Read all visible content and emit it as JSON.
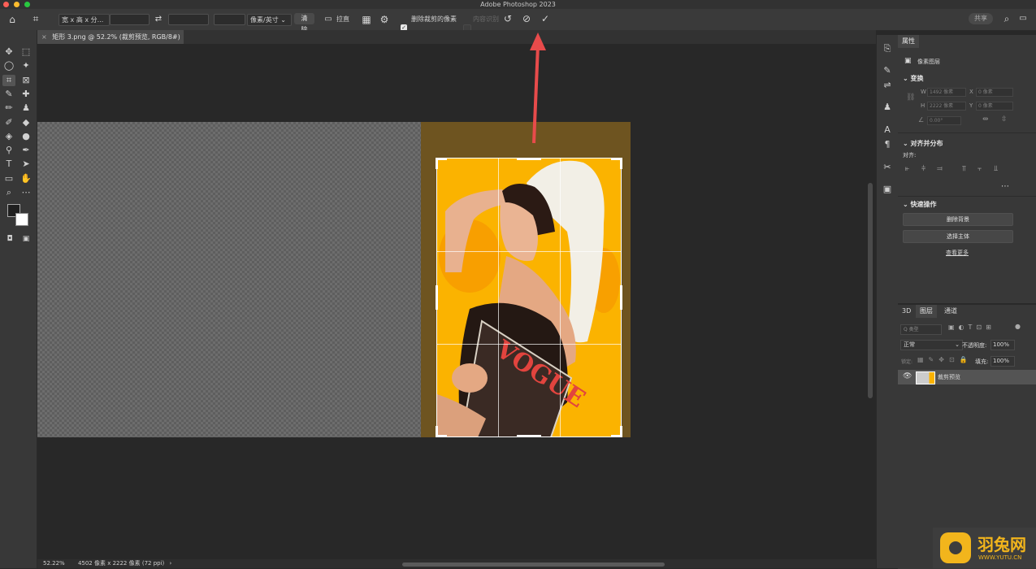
{
  "app": {
    "title": "Adobe Photoshop 2023"
  },
  "options_bar": {
    "ratio_select": "宽 x 高 x 分...",
    "units_select": "像素/英寸",
    "clear_button": "清除",
    "straighten_button": "拉直",
    "delete_cropped_label": "删除裁剪的像素",
    "content_aware_label": "内容识别",
    "share_button": "共享"
  },
  "document": {
    "tab_title": "矩形 3.png @ 52.2% (裁剪预览, RGB/8#) *"
  },
  "canvas": {
    "photo_text": "VOGUE"
  },
  "status": {
    "zoom": "52.22%",
    "doc_info": "4502 像素 x 2222 像素 (72 ppi)",
    "arrow": "›"
  },
  "properties": {
    "tab": "属性",
    "layer_type": "像素图层",
    "transform_title": "变换",
    "w_label": "W",
    "w_value": "1492 像素",
    "x_label": "X",
    "x_value": "0 像素",
    "h_label": "H",
    "h_value": "2222 像素",
    "y_label": "Y",
    "y_value": "0 像素",
    "angle_value": "0.00°",
    "align_title": "对齐并分布",
    "align_label": "对齐:",
    "quick_title": "快速操作",
    "remove_bg_button": "删除背景",
    "select_subject_button": "选择主体",
    "see_more_link": "查看更多"
  },
  "layers": {
    "tabs": [
      "3D",
      "图层",
      "通道"
    ],
    "filter_placeholder": "Q 类型",
    "blend_mode": "正常",
    "opacity_label": "不透明度:",
    "opacity_value": "100%",
    "lock_label": "锁定:",
    "fill_label": "填充:",
    "fill_value": "100%",
    "layer_name": "裁剪预览"
  },
  "watermark": {
    "cn": "羽兔网",
    "url": "WWW.YUTU.CN"
  },
  "colors": {
    "accent_red": "#e84b4b",
    "photo_yellow": "#fbb300",
    "crop_dim": "#6e5420"
  }
}
